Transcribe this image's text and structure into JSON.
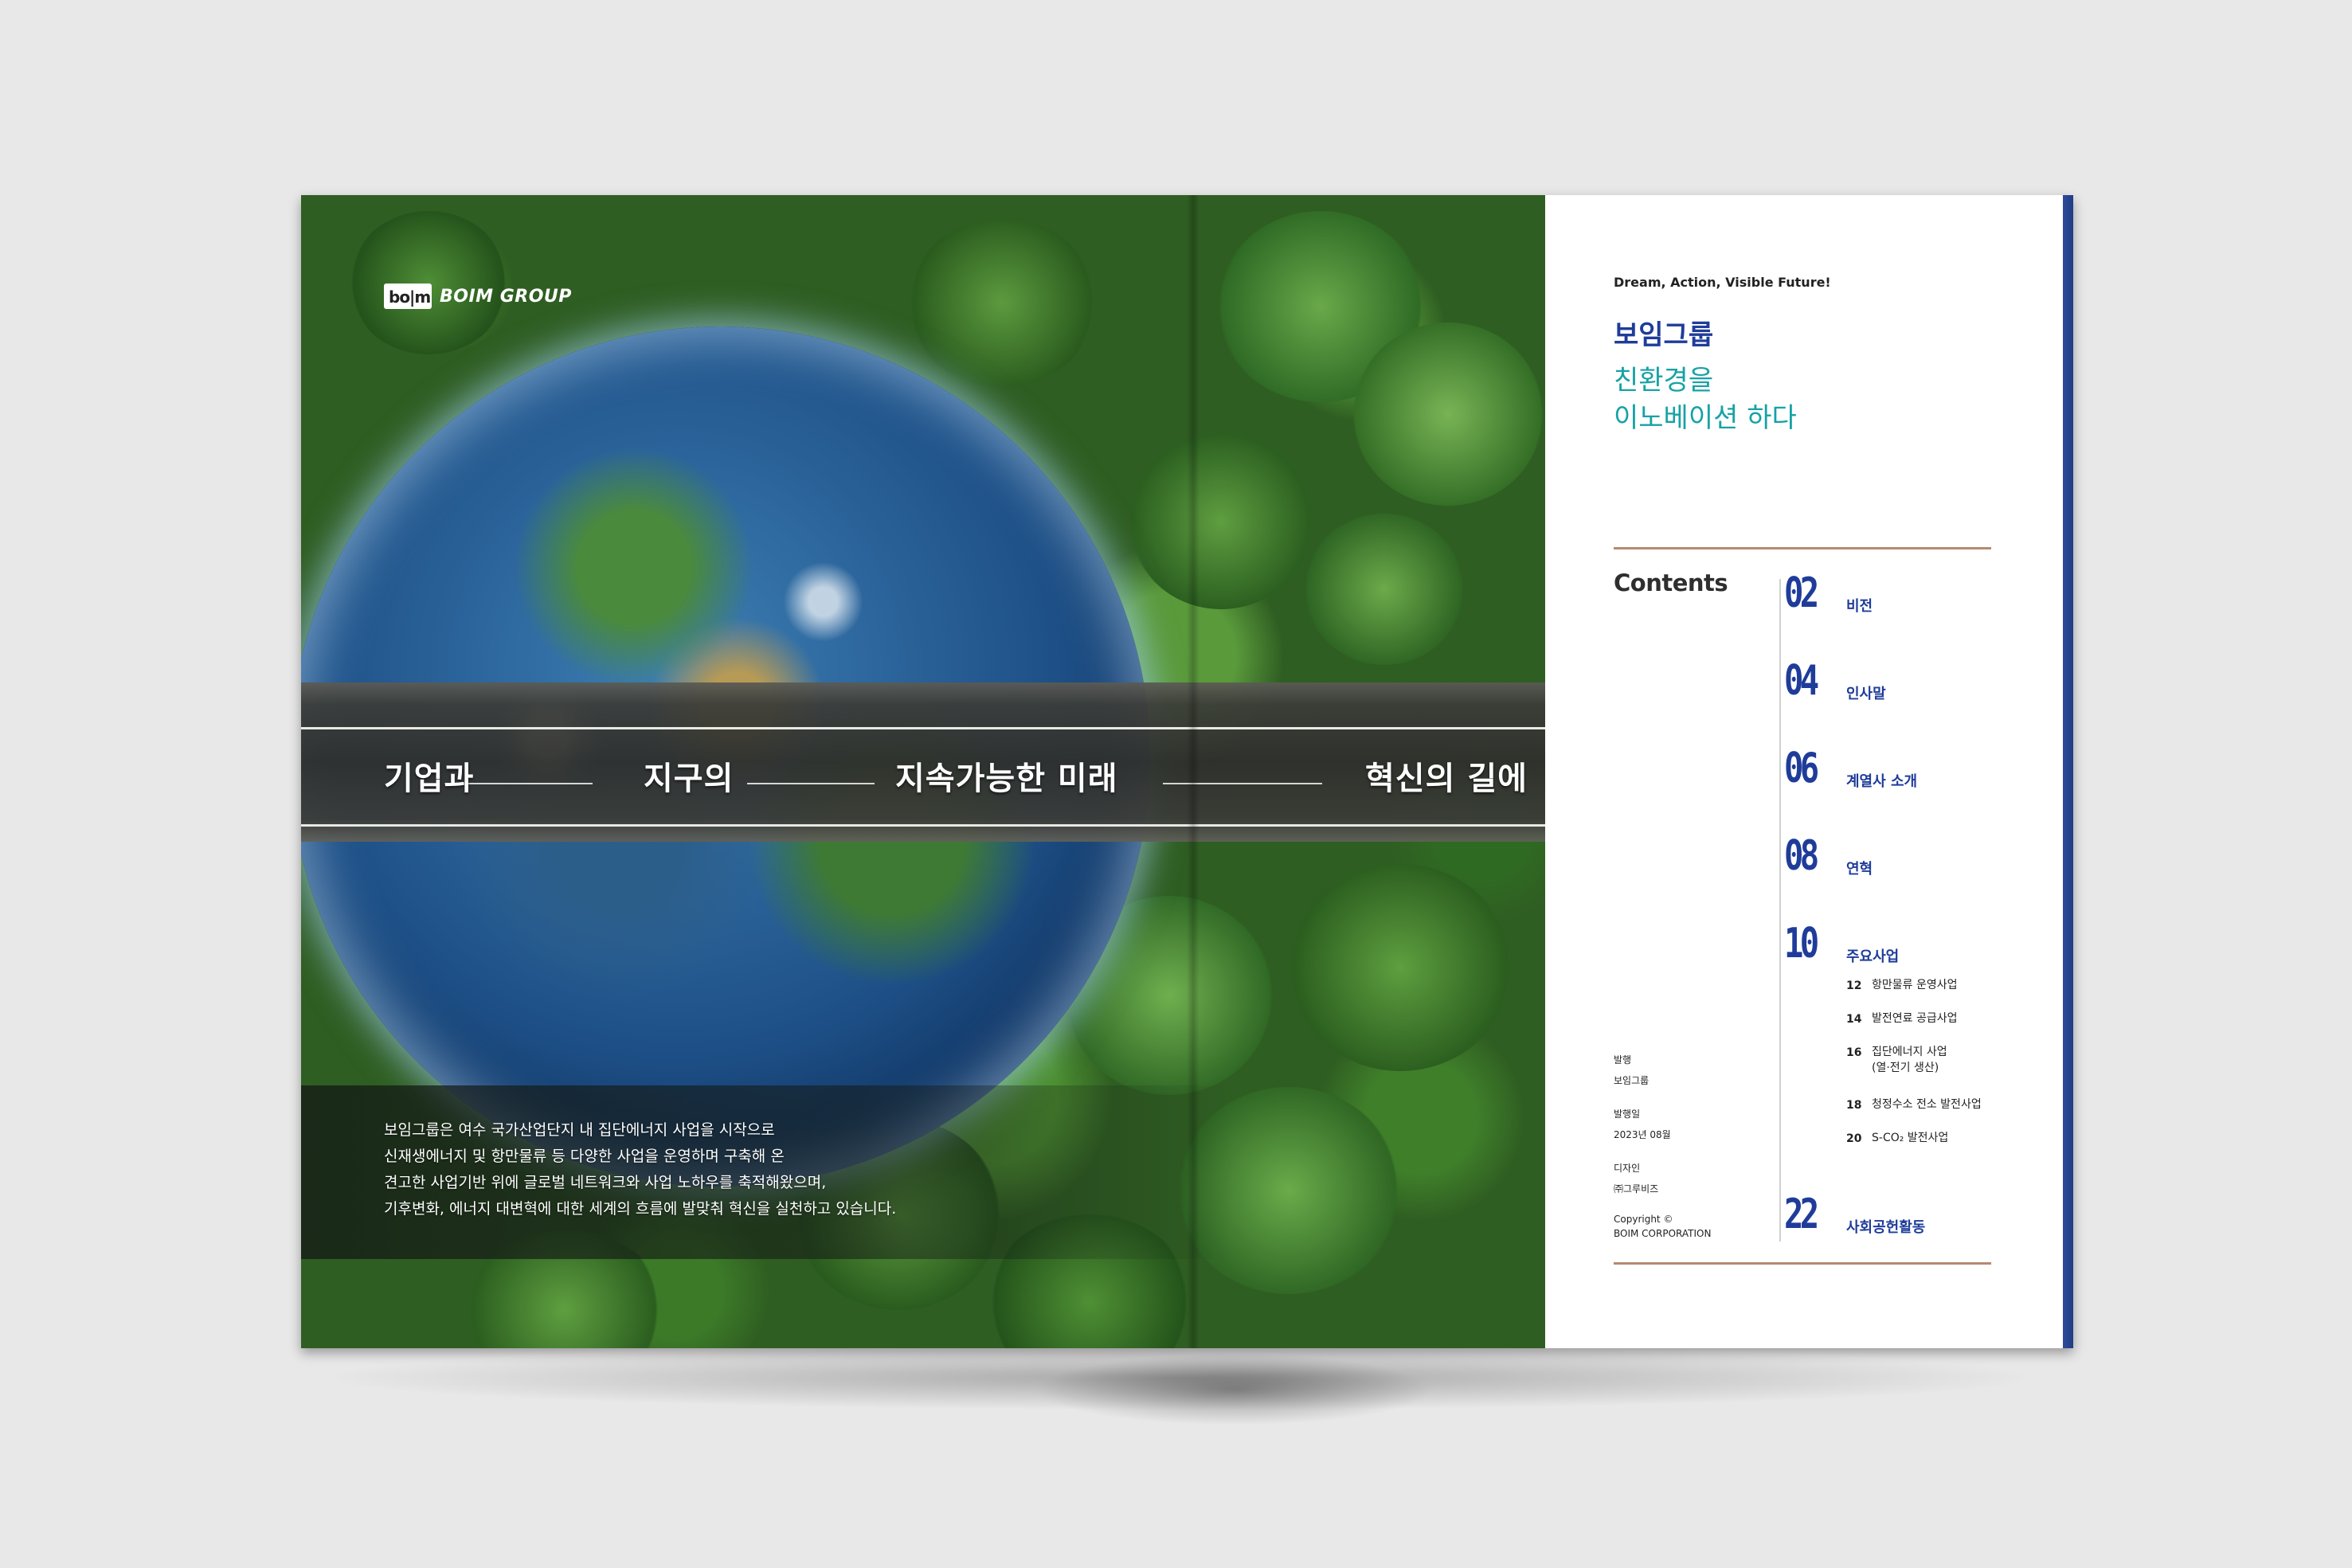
{
  "cover": {
    "logo_mark": "bo|m",
    "logo_text": "BOIM GROUP",
    "title_words": [
      "기업과",
      "지구의",
      "지속가능한 미래",
      "혁신의 길에"
    ],
    "description_lines": [
      "보임그룹은 여수 국가산업단지 내 집단에너지 사업을 시작으로",
      "신재생에너지 및 항만물류 등 다양한 사업을 운영하며 구축해 온",
      "견고한 사업기반 위에 글로벌 네트워크와 사업 노하우를 축적해왔으며,",
      "기후변화, 에너지 대변혁에 대한 세계의 흐름에 발맞춰 혁신을 실천하고 있습니다."
    ]
  },
  "toc_page": {
    "tagline": "Dream, Action, Visible Future!",
    "brand": "보임그룹",
    "headline_lines": [
      "친환경을",
      "이노베이션 하다"
    ],
    "contents_label": "Contents",
    "entries": [
      {
        "num": "02",
        "label": "비전"
      },
      {
        "num": "04",
        "label": "인사말"
      },
      {
        "num": "06",
        "label": "계열사 소개"
      },
      {
        "num": "08",
        "label": "연혁"
      },
      {
        "num": "10",
        "label": "주요사업"
      },
      {
        "num": "22",
        "label": "사회공헌활동"
      }
    ],
    "sub_entries": [
      {
        "num": "12",
        "label": "항만물류 운영사업"
      },
      {
        "num": "14",
        "label": "발전연료 공급사업"
      },
      {
        "num": "16",
        "label": "집단에너지 사업",
        "label2": "(열·전기 생산)"
      },
      {
        "num": "18",
        "label": "청정수소 전소 발전사업"
      },
      {
        "num": "20",
        "label": "S-CO₂ 발전사업"
      }
    ],
    "meta": {
      "publisher_label": "발행",
      "publisher": "보임그룹",
      "date_label": "발행일",
      "date": "2023년 08월",
      "design_label": "디자인",
      "design": "㈜그루비즈",
      "copyright": "Copyright ©",
      "corp": "BOIM CORPORATION"
    }
  },
  "colors": {
    "background": "#e9e8e9",
    "brand_blue": "#1f3c9a",
    "teal": "#17a2a6",
    "rule": "#b48a72"
  }
}
